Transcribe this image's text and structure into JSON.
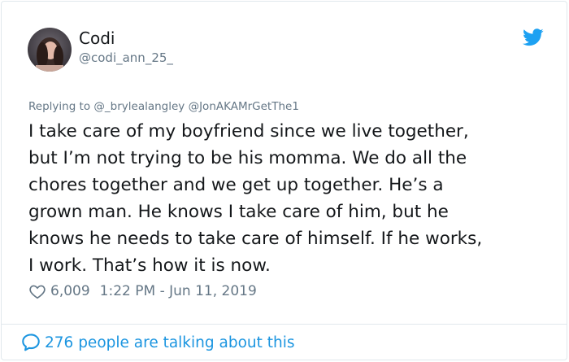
{
  "author": {
    "name": "Codi",
    "handle": "@codi_ann_25_",
    "avatar_icon": "profile-photo",
    "platform_icon": "twitter-bird-icon"
  },
  "reply": {
    "prefix": "Replying to",
    "mentions": "@_brylealangley @JonAKAMrGetThe1"
  },
  "tweet": {
    "text": "I take care of my boyfriend since we live together,\nbut I’m not trying to be his momma. We do all the\nchores together and we get up together. He’s a\ngrown man. He knows I take care of him, but he\nknows he needs to take care of himself. If he works,\nI work. That’s how it is now."
  },
  "meta": {
    "likes": "6,009",
    "timestamp": "1:22 PM - Jun 11, 2019"
  },
  "footer": {
    "talking": "276 people are talking about this"
  },
  "colors": {
    "accent": "#1da1f2",
    "link": "#1b95e0",
    "muted": "#657786",
    "text": "#14171a",
    "border": "#e1e8ed"
  }
}
